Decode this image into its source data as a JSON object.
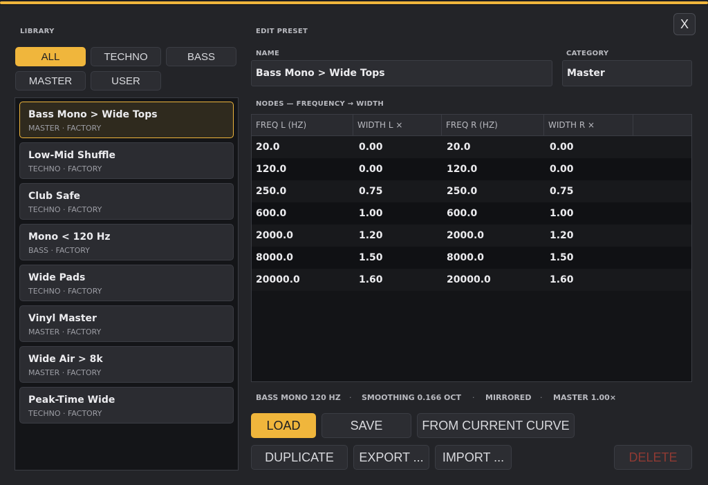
{
  "window": {
    "close_label": "X"
  },
  "library": {
    "label": "LIBRARY",
    "filters": [
      "ALL",
      "TECHNO",
      "BASS",
      "MASTER",
      "USER"
    ],
    "active_filter": "ALL",
    "presets": [
      {
        "name": "Bass Mono > Wide Tops",
        "meta": "MASTER · FACTORY",
        "selected": true
      },
      {
        "name": "Low-Mid Shuffle",
        "meta": "TECHNO · FACTORY"
      },
      {
        "name": "Club Safe",
        "meta": "TECHNO · FACTORY"
      },
      {
        "name": "Mono < 120 Hz",
        "meta": "BASS · FACTORY"
      },
      {
        "name": "Wide Pads",
        "meta": "TECHNO · FACTORY"
      },
      {
        "name": "Vinyl Master",
        "meta": "MASTER · FACTORY"
      },
      {
        "name": "Wide Air > 8k",
        "meta": "MASTER · FACTORY"
      },
      {
        "name": "Peak-Time Wide",
        "meta": "TECHNO · FACTORY"
      }
    ]
  },
  "edit": {
    "label": "EDIT PRESET",
    "name_label": "NAME",
    "name_value": "Bass Mono > Wide Tops",
    "category_label": "CATEGORY",
    "category_value": "Master",
    "nodes_label": "NODES — FREQUENCY → WIDTH",
    "columns": [
      "FREQ L (HZ)",
      "WIDTH L ×",
      "FREQ R (HZ)",
      "WIDTH R ×"
    ],
    "rows": [
      [
        "20.0",
        "0.00",
        "20.0",
        "0.00"
      ],
      [
        "120.0",
        "0.00",
        "120.0",
        "0.00"
      ],
      [
        "250.0",
        "0.75",
        "250.0",
        "0.75"
      ],
      [
        "600.0",
        "1.00",
        "600.0",
        "1.00"
      ],
      [
        "2000.0",
        "1.20",
        "2000.0",
        "1.20"
      ],
      [
        "8000.0",
        "1.50",
        "8000.0",
        "1.50"
      ],
      [
        "20000.0",
        "1.60",
        "20000.0",
        "1.60"
      ]
    ],
    "status": [
      "BASS MONO 120 HZ",
      "SMOOTHING 0.166 OCT",
      "MIRRORED",
      "MASTER 1.00×"
    ],
    "status_separator": "·"
  },
  "actions": {
    "load": "LOAD",
    "save": "SAVE",
    "from_curve": "FROM CURRENT CURVE",
    "duplicate": "DUPLICATE",
    "export": "EXPORT ...",
    "import": "IMPORT ...",
    "delete": "DELETE"
  },
  "colors": {
    "accent": "#f0b63c",
    "background": "#232428",
    "danger": "#8f3a33"
  }
}
